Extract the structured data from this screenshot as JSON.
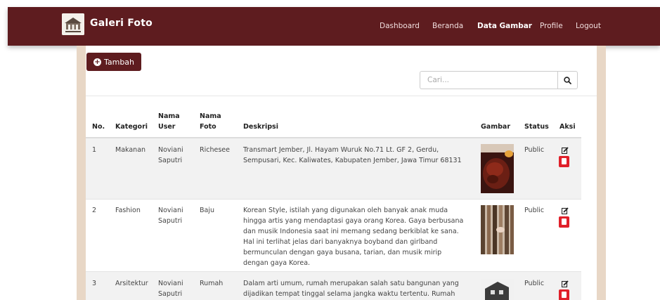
{
  "nav": {
    "brand": "Galeri Foto",
    "links": [
      "Dashboard",
      "Beranda",
      "Data Gambar",
      "Profile",
      "Logout"
    ],
    "active": "Data Gambar"
  },
  "toolbar": {
    "add_label": "Tambah"
  },
  "search": {
    "placeholder": "Cari..."
  },
  "table": {
    "headers": {
      "no": "No.",
      "kategori": "Kategori",
      "nama_user": "Nama User",
      "nama_foto": "Nama Foto",
      "deskripsi": "Deskripsi",
      "gambar": "Gambar",
      "status": "Status",
      "aksi": "Aksi"
    },
    "rows": [
      {
        "no": "1",
        "kategori": "Makanan",
        "nama_user": "Noviani Saputri",
        "nama_foto": "Richesee",
        "deskripsi": "Transmart Jember, Jl. Hayam Wuruk No.71 Lt. GF 2, Gerdu, Sempusari, Kec. Kaliwates, Kabupaten Jember, Jawa Timur 68131",
        "status": "Public"
      },
      {
        "no": "2",
        "kategori": "Fashion",
        "nama_user": "Noviani Saputri",
        "nama_foto": "Baju",
        "deskripsi": "Korean Style, istilah yang digunakan oleh banyak anak muda hingga artis yang mendaptasi gaya orang Korea. Gaya berbusana dan musik Indonesia saat ini memang sedang berkiblat ke sana. Hal ini terlihat jelas dari banyaknya boyband dan girlband bermunculan dengan gaya busana, tarian, dan musik mirip dengan gaya Korea.",
        "status": "Public"
      },
      {
        "no": "3",
        "kategori": "Arsitektur",
        "nama_user": "Noviani Saputri",
        "nama_foto": "Rumah",
        "deskripsi": "Dalam arti umum, rumah merupakan salah satu bangunan yang dijadikan tempat tinggal selama jangka waktu tertentu. Rumah",
        "status": "Public"
      }
    ]
  },
  "colors": {
    "brand": "#5e1c1f",
    "delete": "#e0202a",
    "band": "#e8d7c6"
  }
}
